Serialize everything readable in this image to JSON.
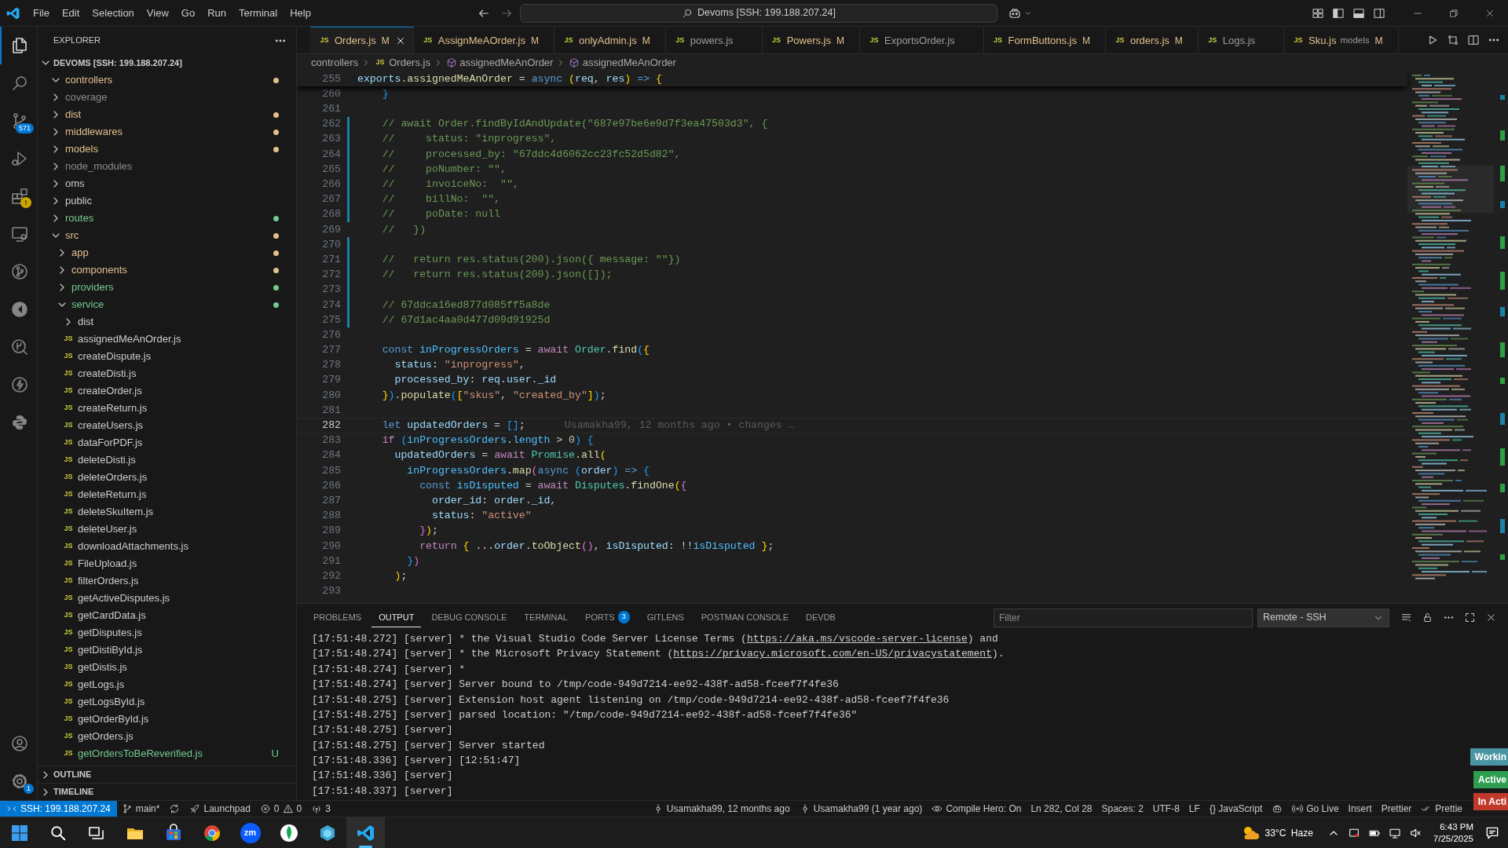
{
  "title_bar": {
    "menu": [
      "File",
      "Edit",
      "Selection",
      "View",
      "Go",
      "Run",
      "Terminal",
      "Help"
    ],
    "command_center": "Devoms [SSH: 199.188.207.24]"
  },
  "activity_bar": {
    "top": [
      {
        "kind": "explorer",
        "selected": true,
        "alert": false
      },
      {
        "kind": "search",
        "selected": false,
        "alert": false
      },
      {
        "kind": "source-control",
        "selected": false,
        "alert": false,
        "badge": "571"
      },
      {
        "kind": "run-debug",
        "selected": false,
        "alert": false
      },
      {
        "kind": "extensions",
        "selected": false,
        "alert": true
      },
      {
        "kind": "remote",
        "selected": false,
        "alert": false
      },
      {
        "kind": "git-graph",
        "selected": false,
        "alert": false
      },
      {
        "kind": "disc",
        "selected": false,
        "alert": false
      },
      {
        "kind": "inspect",
        "selected": false,
        "alert": false
      },
      {
        "kind": "lightning",
        "selected": false,
        "alert": false
      },
      {
        "kind": "python",
        "selected": false,
        "alert": false
      }
    ],
    "bottom": [
      {
        "kind": "account",
        "selected": false,
        "alert": false
      },
      {
        "kind": "settings",
        "selected": false,
        "alert": false,
        "badge": "1"
      }
    ]
  },
  "sidebar": {
    "title": "EXPLORER",
    "root": "DEVOMS [SSH: 199.188.207.24]",
    "root_expanded": true,
    "tree": [
      {
        "label": "controllers",
        "kind": "folder",
        "expanded": true,
        "color": "#e2c08d",
        "dot": true
      },
      {
        "label": "coverage",
        "kind": "folder",
        "expanded": false,
        "color": "#8c8c8c",
        "dot": false
      },
      {
        "label": "dist",
        "kind": "folder",
        "expanded": false,
        "color": "#e2c08d",
        "dot": true
      },
      {
        "label": "middlewares",
        "kind": "folder",
        "expanded": false,
        "color": "#e2c08d",
        "dot": true
      },
      {
        "label": "models",
        "kind": "folder",
        "expanded": false,
        "color": "#e2c08d",
        "dot": true
      },
      {
        "label": "node_modules",
        "kind": "folder",
        "expanded": false,
        "color": "#8c8c8c",
        "dot": false
      },
      {
        "label": "oms",
        "kind": "folder",
        "expanded": false,
        "color": "#cccccc",
        "dot": false
      },
      {
        "label": "public",
        "kind": "folder",
        "expanded": false,
        "color": "#cccccc",
        "dot": false
      },
      {
        "label": "routes",
        "kind": "folder",
        "expanded": false,
        "color": "#73c991",
        "dot": true
      },
      {
        "label": "src",
        "kind": "folder",
        "expanded": true,
        "color": "#e2c08d",
        "dot": true,
        "children": [
          {
            "label": "app",
            "kind": "folder",
            "expanded": false,
            "color": "#e2c08d",
            "dot": true
          },
          {
            "label": "components",
            "kind": "folder",
            "expanded": false,
            "color": "#e2c08d",
            "dot": true
          },
          {
            "label": "providers",
            "kind": "folder",
            "expanded": false,
            "color": "#73c991",
            "dot": true
          },
          {
            "label": "service",
            "kind": "folder",
            "expanded": true,
            "color": "#73c991",
            "dot": true,
            "children": [
              {
                "label": "dist",
                "kind": "folder",
                "expanded": false,
                "color": "#cccccc",
                "dot": false
              },
              {
                "label": "assignedMeAnOrder.js",
                "kind": "file",
                "icon": "JS",
                "color": "#cccccc",
                "dot": false
              },
              {
                "label": "createDispute.js",
                "kind": "file",
                "icon": "JS",
                "color": "#cccccc",
                "dot": false
              },
              {
                "label": "createDisti.js",
                "kind": "file",
                "icon": "JS",
                "color": "#cccccc",
                "dot": false
              },
              {
                "label": "createOrder.js",
                "kind": "file",
                "icon": "JS",
                "color": "#cccccc",
                "dot": false
              },
              {
                "label": "createReturn.js",
                "kind": "file",
                "icon": "JS",
                "color": "#cccccc",
                "dot": false
              },
              {
                "label": "createUsers.js",
                "kind": "file",
                "icon": "JS",
                "color": "#cccccc",
                "dot": false
              },
              {
                "label": "dataForPDF.js",
                "kind": "file",
                "icon": "JS",
                "color": "#cccccc",
                "dot": false
              },
              {
                "label": "deleteDisti.js",
                "kind": "file",
                "icon": "JS",
                "color": "#cccccc",
                "dot": false
              },
              {
                "label": "deleteOrders.js",
                "kind": "file",
                "icon": "JS",
                "color": "#cccccc",
                "dot": false
              },
              {
                "label": "deleteReturn.js",
                "kind": "file",
                "icon": "JS",
                "color": "#cccccc",
                "dot": false
              },
              {
                "label": "deleteSkuItem.js",
                "kind": "file",
                "icon": "JS",
                "color": "#cccccc",
                "dot": false
              },
              {
                "label": "deleteUser.js",
                "kind": "file",
                "icon": "JS",
                "color": "#cccccc",
                "dot": false
              },
              {
                "label": "downloadAttachments.js",
                "kind": "file",
                "icon": "JS",
                "color": "#cccccc",
                "dot": false
              },
              {
                "label": "FileUpload.js",
                "kind": "file",
                "icon": "JS",
                "color": "#cccccc",
                "dot": false
              },
              {
                "label": "filterOrders.js",
                "kind": "file",
                "icon": "JS",
                "color": "#cccccc",
                "dot": false
              },
              {
                "label": "getActiveDisputes.js",
                "kind": "file",
                "icon": "JS",
                "color": "#cccccc",
                "dot": false
              },
              {
                "label": "getCardData.js",
                "kind": "file",
                "icon": "JS",
                "color": "#cccccc",
                "dot": false
              },
              {
                "label": "getDisputes.js",
                "kind": "file",
                "icon": "JS",
                "color": "#cccccc",
                "dot": false
              },
              {
                "label": "getDistiById.js",
                "kind": "file",
                "icon": "JS",
                "color": "#cccccc",
                "dot": false
              },
              {
                "label": "getDistis.js",
                "kind": "file",
                "icon": "JS",
                "color": "#cccccc",
                "dot": false
              },
              {
                "label": "getLogs.js",
                "kind": "file",
                "icon": "JS",
                "color": "#cccccc",
                "dot": false
              },
              {
                "label": "getLogsById.js",
                "kind": "file",
                "icon": "JS",
                "color": "#cccccc",
                "dot": false
              },
              {
                "label": "getOrderById.js",
                "kind": "file",
                "icon": "JS",
                "color": "#cccccc",
                "dot": false
              },
              {
                "label": "getOrders.js",
                "kind": "file",
                "icon": "JS",
                "color": "#cccccc",
                "dot": false
              },
              {
                "label": "getOrdersToBeReverified.js",
                "kind": "file",
                "icon": "JS",
                "color": "#73c991",
                "dot": false,
                "badge": "U"
              }
            ]
          }
        ]
      }
    ],
    "sections": [
      {
        "label": "OUTLINE",
        "expanded": false
      },
      {
        "label": "TIMELINE",
        "expanded": false
      }
    ]
  },
  "editor_tabs": [
    {
      "icon": "JS",
      "label": "Orders.js",
      "decoration": "M",
      "modified": true,
      "selected": true
    },
    {
      "icon": "JS",
      "label": "AssignMeAOrder.js",
      "decoration": "M",
      "modified": true,
      "selected": false
    },
    {
      "icon": "JS",
      "label": "onlyAdmin.js",
      "decoration": "M",
      "modified": true,
      "selected": false
    },
    {
      "icon": "JS",
      "label": "powers.js",
      "modified": false,
      "selected": false
    },
    {
      "icon": "JS",
      "label": "Powers.js",
      "decoration": "M",
      "modified": true,
      "selected": false
    },
    {
      "icon": "JS",
      "label": "ExportsOrder.js",
      "modified": false,
      "selected": false
    },
    {
      "icon": "JS",
      "label": "FormButtons.js",
      "decoration": "M",
      "modified": true,
      "selected": false
    },
    {
      "icon": "JS",
      "label": "orders.js",
      "decoration": "M",
      "modified": true,
      "selected": false
    },
    {
      "icon": "JS",
      "label": "Logs.js",
      "modified": false,
      "selected": false
    },
    {
      "icon": "JS",
      "label": "Sku.js",
      "description": "models",
      "decoration": "M",
      "modified": true,
      "selected": false
    }
  ],
  "breadcrumb": [
    {
      "kind": "folder",
      "text": "controllers"
    },
    {
      "kind": "file",
      "icon": "JS",
      "text": "Orders.js"
    },
    {
      "kind": "symbol",
      "text": "assignedMeAnOrder"
    },
    {
      "kind": "symbol",
      "text": "assignedMeAnOrder"
    }
  ],
  "editor": {
    "sticky_line": {
      "num": "255",
      "tokens": [
        {
          "t": "exports",
          "kind": "var"
        },
        {
          "t": ".",
          "kind": "p"
        },
        {
          "t": "assignedMeAnOrder",
          "kind": "fn"
        },
        {
          "t": " = ",
          "kind": "p"
        },
        {
          "t": "async ",
          "kind": "kw"
        },
        {
          "t": "(",
          "kind": "b1"
        },
        {
          "t": "req",
          "kind": "var"
        },
        {
          "t": ", ",
          "kind": "p"
        },
        {
          "t": "res",
          "kind": "var"
        },
        {
          "t": ") ",
          "kind": "b1"
        },
        {
          "t": "=> ",
          "kind": "kw"
        },
        {
          "t": "{",
          "kind": "b1"
        }
      ]
    },
    "lines": [
      {
        "num": "260",
        "changed": false,
        "current": false,
        "tokens": [
          {
            "t": "    }",
            "kind": "b3"
          }
        ]
      },
      {
        "num": "261",
        "changed": false,
        "current": false
      },
      {
        "num": "262",
        "changed": true,
        "current": false,
        "tokens": [
          {
            "t": "    // await Order.findByIdAndUpdate(\"687e97be6e9d7f3ea47503d3\", {",
            "kind": "com"
          }
        ]
      },
      {
        "num": "263",
        "changed": true,
        "current": false,
        "tokens": [
          {
            "t": "    //     status: \"inprogress\",",
            "kind": "com"
          }
        ]
      },
      {
        "num": "264",
        "changed": true,
        "current": false,
        "tokens": [
          {
            "t": "    //     processed_by: \"67ddc4d6062cc23fc52d5d82\",",
            "kind": "com"
          }
        ]
      },
      {
        "num": "265",
        "changed": true,
        "current": false,
        "tokens": [
          {
            "t": "    //     poNumber: \"\",",
            "kind": "com"
          }
        ]
      },
      {
        "num": "266",
        "changed": true,
        "current": false,
        "tokens": [
          {
            "t": "    //     invoiceNo:  \"\",",
            "kind": "com"
          }
        ]
      },
      {
        "num": "267",
        "changed": true,
        "current": false,
        "tokens": [
          {
            "t": "    //     billNo:  \"\",",
            "kind": "com"
          }
        ]
      },
      {
        "num": "268",
        "changed": true,
        "current": false,
        "tokens": [
          {
            "t": "    //     poDate: null",
            "kind": "com"
          }
        ]
      },
      {
        "num": "269",
        "changed": false,
        "current": false,
        "tokens": [
          {
            "t": "    //   })",
            "kind": "com"
          }
        ]
      },
      {
        "num": "270",
        "changed": true,
        "current": false
      },
      {
        "num": "271",
        "changed": true,
        "current": false,
        "tokens": [
          {
            "t": "    //   return res.status(200).json({ message: \"\"})",
            "kind": "com"
          }
        ]
      },
      {
        "num": "272",
        "changed": true,
        "current": false,
        "tokens": [
          {
            "t": "    //   return res.status(200).json([]);",
            "kind": "com"
          }
        ]
      },
      {
        "num": "273",
        "changed": true,
        "current": false
      },
      {
        "num": "274",
        "changed": true,
        "current": false,
        "tokens": [
          {
            "t": "    // 67ddca16ed877d085ff5a8de",
            "kind": "com"
          }
        ]
      },
      {
        "num": "275",
        "changed": true,
        "current": false,
        "tokens": [
          {
            "t": "    // 67d1ac4aa0d477d09d91925d",
            "kind": "com"
          }
        ]
      },
      {
        "num": "276",
        "changed": false,
        "current": false
      },
      {
        "num": "277",
        "changed": false,
        "current": false,
        "tokens": [
          {
            "t": "    const ",
            "kind": "kw"
          },
          {
            "t": "inProgressOrders",
            "kind": "cst"
          },
          {
            "t": " = ",
            "kind": "p"
          },
          {
            "t": "await ",
            "kind": "ctl"
          },
          {
            "t": "Order",
            "kind": "cls"
          },
          {
            "t": ".",
            "kind": "p"
          },
          {
            "t": "find",
            "kind": "fn"
          },
          {
            "t": "(",
            "kind": "b3"
          },
          {
            "t": "{",
            "kind": "b1"
          }
        ]
      },
      {
        "num": "278",
        "changed": false,
        "current": false,
        "tokens": [
          {
            "t": "      status",
            "kind": "var"
          },
          {
            "t": ": ",
            "kind": "p"
          },
          {
            "t": "\"inprogress\"",
            "kind": "str"
          },
          {
            "t": ",",
            "kind": "p"
          }
        ]
      },
      {
        "num": "279",
        "changed": false,
        "current": false,
        "tokens": [
          {
            "t": "      processed_by",
            "kind": "var"
          },
          {
            "t": ": ",
            "kind": "p"
          },
          {
            "t": "req",
            "kind": "var"
          },
          {
            "t": ".",
            "kind": "p"
          },
          {
            "t": "user",
            "kind": "var"
          },
          {
            "t": ".",
            "kind": "p"
          },
          {
            "t": "_id",
            "kind": "var"
          }
        ]
      },
      {
        "num": "280",
        "changed": false,
        "current": false,
        "tokens": [
          {
            "t": "    }",
            "kind": "b1"
          },
          {
            "t": ")",
            "kind": "b3"
          },
          {
            "t": ".",
            "kind": "p"
          },
          {
            "t": "populate",
            "kind": "fn"
          },
          {
            "t": "(",
            "kind": "b3"
          },
          {
            "t": "[",
            "kind": "b1"
          },
          {
            "t": "\"skus\"",
            "kind": "str"
          },
          {
            "t": ", ",
            "kind": "p"
          },
          {
            "t": "\"created_by\"",
            "kind": "str"
          },
          {
            "t": "]",
            "kind": "b1"
          },
          {
            "t": ")",
            "kind": "b3"
          },
          {
            "t": ";",
            "kind": "p"
          }
        ]
      },
      {
        "num": "281",
        "changed": false,
        "current": false
      },
      {
        "num": "282",
        "changed": false,
        "current": true,
        "tokens": [
          {
            "t": "    let ",
            "kind": "kw"
          },
          {
            "t": "updatedOrders",
            "kind": "var"
          },
          {
            "t": " = ",
            "kind": "p"
          },
          {
            "t": "[]",
            "kind": "b3"
          },
          {
            "t": ";",
            "kind": "p"
          }
        ],
        "blame": "Usamakha99, 12 months ago • changes …"
      },
      {
        "num": "283",
        "changed": false,
        "current": false,
        "tokens": [
          {
            "t": "    if ",
            "kind": "ctl"
          },
          {
            "t": "(",
            "kind": "b3"
          },
          {
            "t": "inProgressOrders",
            "kind": "cst"
          },
          {
            "t": ".",
            "kind": "p"
          },
          {
            "t": "length",
            "kind": "cst"
          },
          {
            "t": " > ",
            "kind": "p"
          },
          {
            "t": "0",
            "kind": "num"
          },
          {
            "t": ") ",
            "kind": "b3"
          },
          {
            "t": "{",
            "kind": "b3"
          }
        ]
      },
      {
        "num": "284",
        "changed": false,
        "current": false,
        "tokens": [
          {
            "t": "      updatedOrders",
            "kind": "var"
          },
          {
            "t": " = ",
            "kind": "p"
          },
          {
            "t": "await ",
            "kind": "ctl"
          },
          {
            "t": "Promise",
            "kind": "cls"
          },
          {
            "t": ".",
            "kind": "p"
          },
          {
            "t": "all",
            "kind": "fn"
          },
          {
            "t": "(",
            "kind": "b1"
          }
        ]
      },
      {
        "num": "285",
        "changed": false,
        "current": false,
        "tokens": [
          {
            "t": "        inProgressOrders",
            "kind": "cst"
          },
          {
            "t": ".",
            "kind": "p"
          },
          {
            "t": "map",
            "kind": "fn"
          },
          {
            "t": "(",
            "kind": "b2"
          },
          {
            "t": "async ",
            "kind": "kw"
          },
          {
            "t": "(",
            "kind": "b3"
          },
          {
            "t": "order",
            "kind": "var"
          },
          {
            "t": ") ",
            "kind": "b3"
          },
          {
            "t": "=> ",
            "kind": "kw"
          },
          {
            "t": "{",
            "kind": "b3"
          }
        ]
      },
      {
        "num": "286",
        "changed": false,
        "current": false,
        "tokens": [
          {
            "t": "          const ",
            "kind": "kw"
          },
          {
            "t": "isDisputed",
            "kind": "cst"
          },
          {
            "t": " = ",
            "kind": "p"
          },
          {
            "t": "await ",
            "kind": "ctl"
          },
          {
            "t": "Disputes",
            "kind": "cls"
          },
          {
            "t": ".",
            "kind": "p"
          },
          {
            "t": "findOne",
            "kind": "fn"
          },
          {
            "t": "(",
            "kind": "b1"
          },
          {
            "t": "{",
            "kind": "b2"
          }
        ]
      },
      {
        "num": "287",
        "changed": false,
        "current": false,
        "tokens": [
          {
            "t": "            order_id",
            "kind": "var"
          },
          {
            "t": ": ",
            "kind": "p"
          },
          {
            "t": "order",
            "kind": "var"
          },
          {
            "t": ".",
            "kind": "p"
          },
          {
            "t": "_id",
            "kind": "var"
          },
          {
            "t": ",",
            "kind": "p"
          }
        ]
      },
      {
        "num": "288",
        "changed": false,
        "current": false,
        "tokens": [
          {
            "t": "            status",
            "kind": "var"
          },
          {
            "t": ": ",
            "kind": "p"
          },
          {
            "t": "\"active\"",
            "kind": "str"
          }
        ]
      },
      {
        "num": "289",
        "changed": false,
        "current": false,
        "tokens": [
          {
            "t": "          }",
            "kind": "b2"
          },
          {
            "t": ")",
            "kind": "b1"
          },
          {
            "t": ";",
            "kind": "p"
          }
        ]
      },
      {
        "num": "290",
        "changed": false,
        "current": false,
        "tokens": [
          {
            "t": "          return ",
            "kind": "ctl"
          },
          {
            "t": "{",
            "kind": "b1"
          },
          {
            "t": " ...",
            "kind": "p"
          },
          {
            "t": "order",
            "kind": "var"
          },
          {
            "t": ".",
            "kind": "p"
          },
          {
            "t": "toObject",
            "kind": "fn"
          },
          {
            "t": "()",
            "kind": "b2"
          },
          {
            "t": ", ",
            "kind": "p"
          },
          {
            "t": "isDisputed",
            "kind": "var"
          },
          {
            "t": ": !!",
            "kind": "p"
          },
          {
            "t": "isDisputed ",
            "kind": "cst"
          },
          {
            "t": "}",
            "kind": "b1"
          },
          {
            "t": ";",
            "kind": "p"
          }
        ]
      },
      {
        "num": "291",
        "changed": false,
        "current": false,
        "tokens": [
          {
            "t": "        }",
            "kind": "b3"
          },
          {
            "t": ")",
            "kind": "b2"
          }
        ]
      },
      {
        "num": "292",
        "changed": false,
        "current": false,
        "tokens": [
          {
            "t": "      )",
            "kind": "b1"
          },
          {
            "t": ";",
            "kind": "p"
          }
        ]
      },
      {
        "num": "293",
        "changed": false,
        "current": false
      }
    ]
  },
  "panel": {
    "tabs": [
      {
        "label": "PROBLEMS",
        "selected": false
      },
      {
        "label": "OUTPUT",
        "selected": true
      },
      {
        "label": "DEBUG CONSOLE",
        "selected": false
      },
      {
        "label": "TERMINAL",
        "selected": false
      },
      {
        "label": "PORTS",
        "selected": false,
        "badge": "3"
      },
      {
        "label": "GITLENS",
        "selected": false
      },
      {
        "label": "POSTMAN CONSOLE",
        "selected": false
      },
      {
        "label": "DEVDB",
        "selected": false
      }
    ],
    "filter": {
      "placeholder": "Filter"
    },
    "channel": "Remote - SSH",
    "output": [
      [
        {
          "t": "[17:51:48.272] [server] * the Visual Studio Code Server License Terms (",
          "link": false
        },
        {
          "t": "https://aka.ms/vscode-server-license",
          "link": true
        },
        {
          "t": ") and",
          "link": false
        }
      ],
      [
        {
          "t": "[17:51:48.274] [server] * the Microsoft Privacy Statement (",
          "link": false
        },
        {
          "t": "https://privacy.microsoft.com/en-US/privacystatement",
          "link": true
        },
        {
          "t": ").",
          "link": false
        }
      ],
      [
        {
          "t": "[17:51:48.274] [server] *",
          "link": false
        }
      ],
      [
        {
          "t": "[17:51:48.274] [server] Server bound to /tmp/code-949d7214-ee92-438f-ad58-fceef7f4fe36",
          "link": false
        }
      ],
      [
        {
          "t": "[17:51:48.275] [server] Extension host agent listening on /tmp/code-949d7214-ee92-438f-ad58-fceef7f4fe36",
          "link": false
        }
      ],
      [
        {
          "t": "[17:51:48.275] [server] parsed location: \"/tmp/code-949d7214-ee92-438f-ad58-fceef7f4fe36\"",
          "link": false
        }
      ],
      [
        {
          "t": "[17:51:48.275] [server]",
          "link": false
        }
      ],
      [
        {
          "t": "[17:51:48.275] [server] Server started",
          "link": false
        }
      ],
      [
        {
          "t": "[17:51:48.336] [server] [12:51:47]",
          "link": false
        }
      ],
      [
        {
          "t": "[17:51:48.336] [server]",
          "link": false
        }
      ],
      [
        {
          "t": "[17:51:48.337] [server]",
          "link": false
        }
      ]
    ]
  },
  "floating_tags": [
    {
      "text": "Workin",
      "color": "#4a95a3"
    },
    {
      "text": "Active",
      "color": "#2f9e50"
    },
    {
      "text": "In Acti",
      "color": "#c0392b"
    }
  ],
  "status_bar": {
    "left": [
      {
        "kind": "remote",
        "text": "SSH: 199.188.207.24"
      },
      {
        "kind": "branch",
        "text": "main*"
      },
      {
        "kind": "sync"
      },
      {
        "kind": "launchpad",
        "text": "Launchpad"
      },
      {
        "kind": "problems",
        "errors": "0",
        "warnings": "0"
      },
      {
        "kind": "ports",
        "text": "3"
      }
    ],
    "right": [
      {
        "kind": "commit",
        "text": "Usamakha99, 12 months ago"
      },
      {
        "kind": "commit",
        "text": "Usamakha99 (1 year ago)"
      },
      {
        "kind": "eye",
        "text": "Compile Hero: On"
      },
      {
        "kind": "plain",
        "text": "Ln 282, Col 28"
      },
      {
        "kind": "plain",
        "text": "Spaces: 2"
      },
      {
        "kind": "plain",
        "text": "UTF-8"
      },
      {
        "kind": "plain",
        "text": "LF"
      },
      {
        "kind": "plain",
        "text": "{} JavaScript"
      },
      {
        "kind": "copilot"
      },
      {
        "kind": "broadcast",
        "text": "Go Live"
      },
      {
        "kind": "plain",
        "text": "Insert"
      },
      {
        "kind": "plain",
        "text": "Prettier"
      },
      {
        "kind": "check",
        "text": "Prettie"
      }
    ]
  },
  "taskbar": {
    "apps": [
      {
        "kind": "start",
        "active": false
      },
      {
        "kind": "search",
        "active": false
      },
      {
        "kind": "task-view",
        "active": false
      },
      {
        "kind": "folder",
        "active": false
      },
      {
        "kind": "store",
        "active": false
      },
      {
        "kind": "chrome",
        "active": false
      },
      {
        "kind": "zoom",
        "label": "zm",
        "active": false
      },
      {
        "kind": "leaf",
        "active": false
      },
      {
        "kind": "gem",
        "active": false
      },
      {
        "kind": "vscode",
        "active": true
      }
    ],
    "weather": {
      "temp": "33°C",
      "text": "Haze"
    },
    "time": "6:43 PM",
    "date": "7/25/2025"
  }
}
